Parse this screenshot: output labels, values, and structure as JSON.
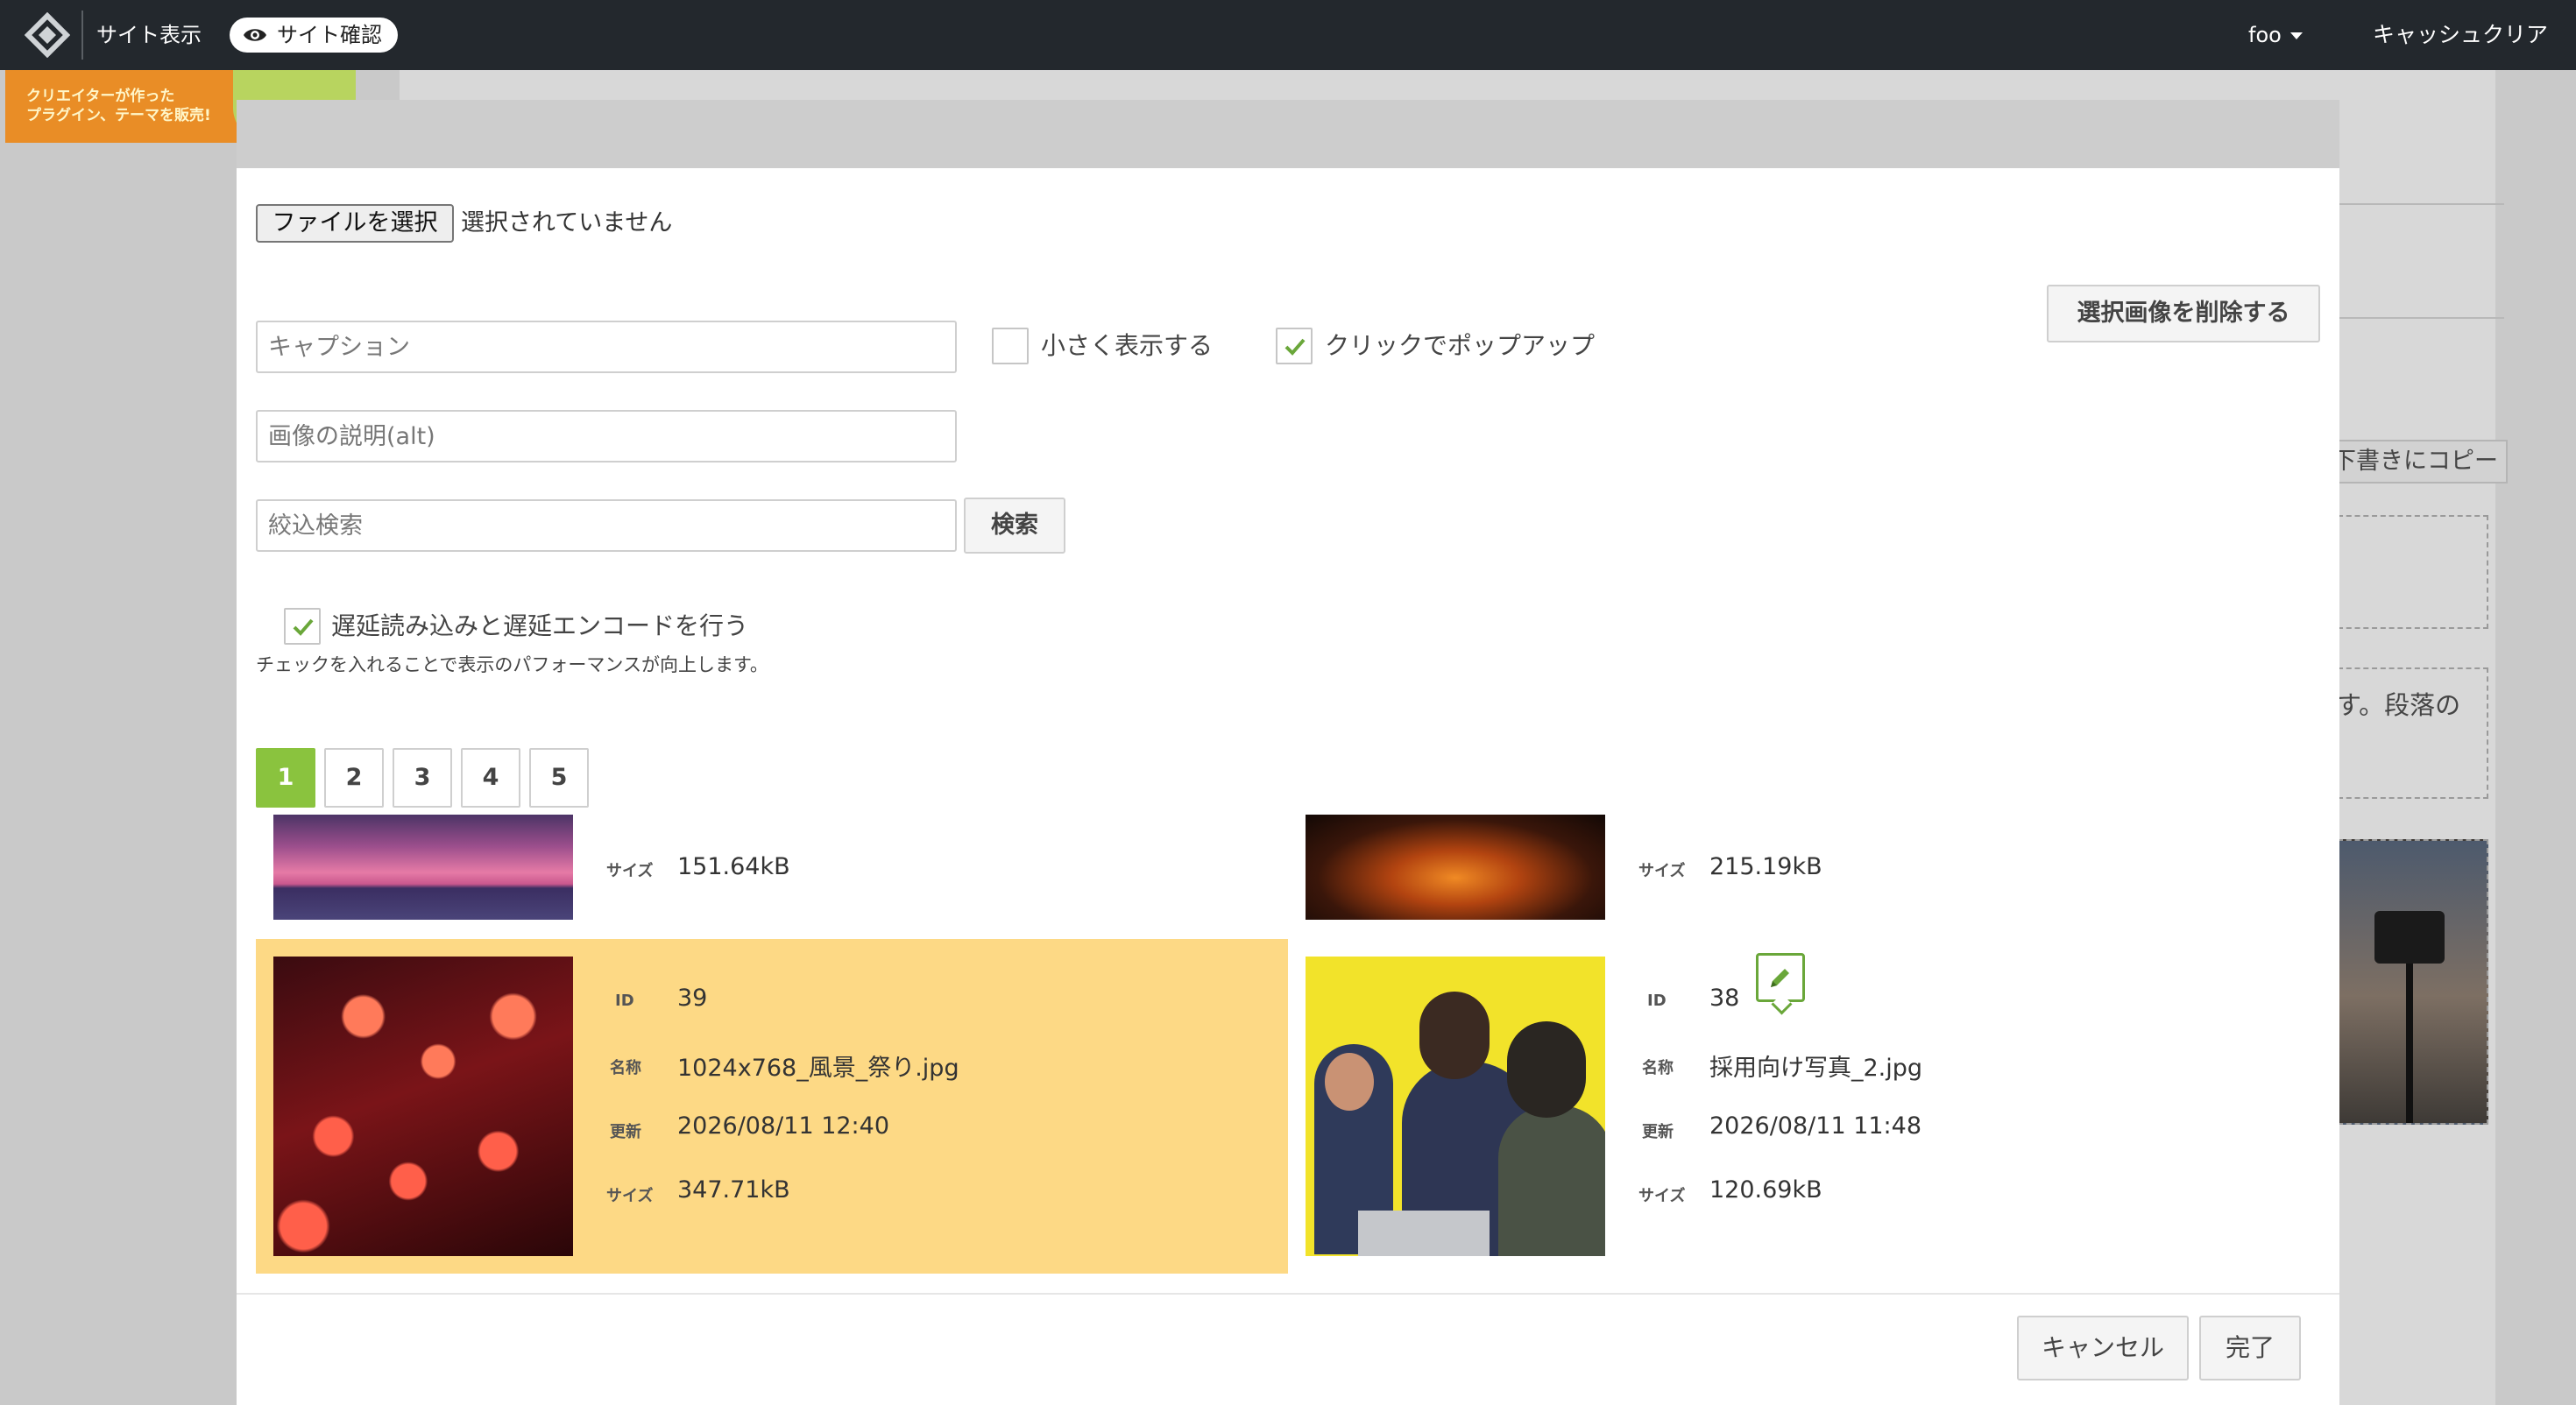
{
  "topbar": {
    "site_view": "サイト表示",
    "site_check": "サイト確認",
    "user": "foo",
    "cache_clear": "キャッシュクリア",
    "bg_color": "#23282d"
  },
  "background": {
    "banner_line1": "クリエイターが作った",
    "banner_line2": "プラグイン、テーマを販売!",
    "copy_button": "下書きにコピー",
    "paragraph_fragment": "す。段落の"
  },
  "dialog": {
    "file_button": "ファイルを選択",
    "file_status": "選択されていません",
    "caption_placeholder": "キャプション",
    "alt_placeholder": "画像の説明(alt)",
    "filter_placeholder": "絞込検索",
    "search_button": "検索",
    "small_display_label": "小さく表示する",
    "small_display_checked": false,
    "popup_label": "クリックでポップアップ",
    "popup_checked": true,
    "delete_button": "選択画像を削除する",
    "lazy_label": "遅延読み込みと遅延エンコードを行う",
    "lazy_checked": true,
    "hint": "チェックを入れることで表示のパフォーマンスが向上します。",
    "pages": [
      "1",
      "2",
      "3",
      "4",
      "5"
    ],
    "current_page": "1",
    "accent_color": "#8ac33e",
    "selected_color": "#fdd985",
    "cancel_button": "キャンセル",
    "done_button": "完了"
  },
  "labels": {
    "id": "ID",
    "name": "名称",
    "updated": "更新",
    "size": "サイズ"
  },
  "images": [
    {
      "size": "151.64kB"
    },
    {
      "size": "215.19kB"
    },
    {
      "id": "39",
      "name": "1024x768_風景_祭り.jpg",
      "updated": "2026/08/11 12:40",
      "size": "347.71kB",
      "selected": true
    },
    {
      "id": "38",
      "name": "採用向け写真_2.jpg",
      "updated": "2026/08/11 11:48",
      "size": "120.69kB",
      "selected": false,
      "icon": "pencil-icon"
    }
  ]
}
